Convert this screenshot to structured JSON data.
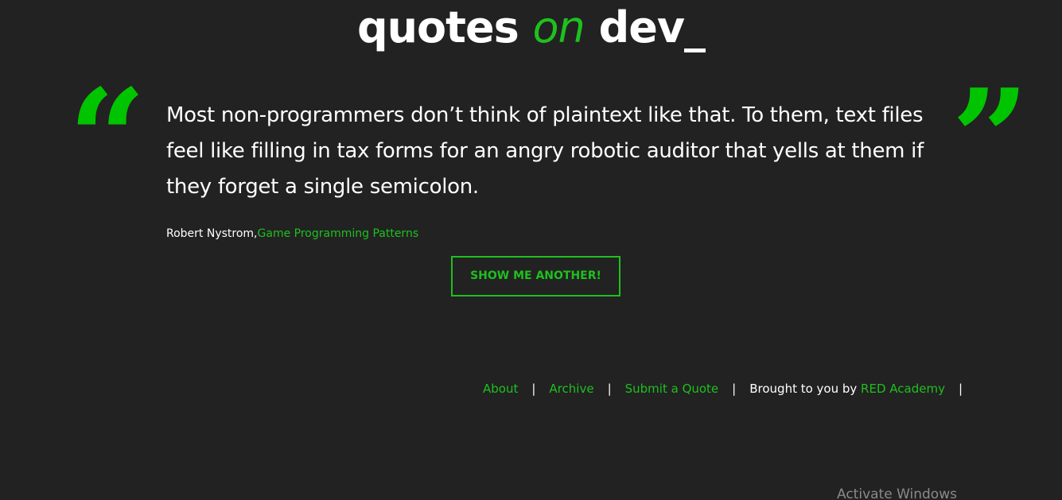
{
  "logo": {
    "part1": "quotes ",
    "part2": "on",
    "part3": " dev_"
  },
  "quote": {
    "text": "Most non-programmers don’t think of plaintext like that. To them, text files feel like filling in tax forms for an angry robotic auditor that yells at them if they forget a single semicolon.",
    "author": "Robert Nystrom,",
    "source": "Game Programming Patterns"
  },
  "actions": {
    "show_another": "SHOW ME ANOTHER!"
  },
  "footer": {
    "about": "About",
    "archive": "Archive",
    "submit": "Submit a Quote",
    "brought_prefix": "Brought to you by ",
    "brought_link": "RED Academy",
    "separator": "|"
  },
  "watermark": "Activate Windows",
  "colors": {
    "background": "#222222",
    "accent": "#1ec01e",
    "text": "#ffffff"
  },
  "icons": {
    "open_quote": "“",
    "close_quote": "”"
  }
}
